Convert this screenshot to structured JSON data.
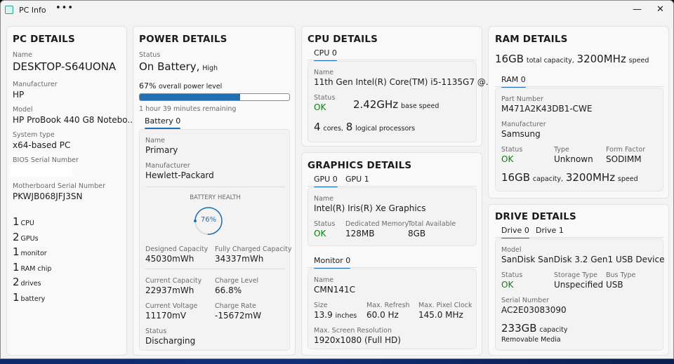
{
  "window": {
    "title": "PC Info",
    "more": "•••",
    "minimize": "—",
    "close": "✕"
  },
  "pc": {
    "heading": "PC DETAILS",
    "name_label": "Name",
    "name": "DESKTOP-S64UONA",
    "manufacturer_label": "Manufacturer",
    "manufacturer": "HP",
    "model_label": "Model",
    "model": "HP ProBook 440 G8 Notebo...",
    "system_type_label": "System type",
    "system_type": "x64-based PC",
    "bios_serial_label": "BIOS Serial Number",
    "mb_serial_label": "Motherboard Serial Number",
    "mb_serial": "PKWJB068JFJ3SN",
    "counts": [
      {
        "n": "1",
        "t": "CPU"
      },
      {
        "n": "2",
        "t": "GPUs"
      },
      {
        "n": "1",
        "t": "monitor"
      },
      {
        "n": "1",
        "t": "RAM chip"
      },
      {
        "n": "2",
        "t": "drives"
      },
      {
        "n": "1",
        "t": "battery"
      }
    ]
  },
  "power": {
    "heading": "POWER DETAILS",
    "status_label": "Status",
    "status": "On Battery,",
    "status_level": "High",
    "level_pct": "67%",
    "level_text": "overall power level",
    "level_value": 0.67,
    "remaining": "1 hour 39 minutes remaining",
    "tab": "Battery 0",
    "name_label": "Name",
    "name": "Primary",
    "manufacturer_label": "Manufacturer",
    "manufacturer": "Hewlett-Packard",
    "health_label": "BATTERY HEALTH",
    "health": "76%",
    "health_value": 0.76,
    "designed_label": "Designed Capacity",
    "designed": "45030mWh",
    "full_label": "Fully Charged Capacity",
    "full": "34337mWh",
    "current_cap_label": "Current Capacity",
    "current_cap": "22937mWh",
    "charge_level_label": "Charge Level",
    "charge_level": "66.8%",
    "voltage_label": "Current Voltage",
    "voltage": "11170mV",
    "rate_label": "Charge Rate",
    "rate": "-15672mW",
    "bstatus_label": "Status",
    "bstatus": "Discharging"
  },
  "cpu": {
    "heading": "CPU DETAILS",
    "tab": "CPU 0",
    "name_label": "Name",
    "name": "11th Gen Intel(R) Core(TM) i5-1135G7 @...",
    "status_label": "Status",
    "status": "OK",
    "speed": "2.42GHz",
    "speed_unit": "base speed",
    "cores": "4",
    "cores_unit": "cores,",
    "logical": "8",
    "logical_unit": "logical processors"
  },
  "gpu": {
    "heading": "GRAPHICS DETAILS",
    "tabs": [
      "GPU 0",
      "GPU 1"
    ],
    "name_label": "Name",
    "name": "Intel(R) Iris(R) Xe Graphics",
    "status_label": "Status",
    "status": "OK",
    "mem_label": "Dedicated Memory",
    "mem": "128MB",
    "total_label": "Total Available",
    "total": "8GB",
    "monitor_tab": "Monitor 0",
    "mon_name_label": "Name",
    "mon_name": "CMN141C",
    "size_label": "Size",
    "size": "13.9",
    "size_unit": "inches",
    "refresh_label": "Max. Refresh",
    "refresh": "60.0 Hz",
    "clock_label": "Max. Pixel Clock",
    "clock": "145.0 MHz",
    "res_label": "Max. Screen Resolution",
    "res": "1920x1080 (Full HD)"
  },
  "ram": {
    "heading": "RAM DETAILS",
    "total": "16GB",
    "total_unit": "total capacity,",
    "speed": "3200MHz",
    "speed_unit": "speed",
    "tab": "RAM 0",
    "part_label": "Part Number",
    "part": "M471A2K43DB1-CWE",
    "manufacturer_label": "Manufacturer",
    "manufacturer": "Samsung",
    "status_label": "Status",
    "status": "OK",
    "type_label": "Type",
    "type": "Unknown",
    "form_label": "Form Factor",
    "form": "SODIMM",
    "cap": "16GB",
    "cap_unit": "capacity,",
    "cap_speed": "3200MHz",
    "cap_speed_unit": "speed"
  },
  "drive": {
    "heading": "DRIVE DETAILS",
    "tabs": [
      "Drive 0",
      "Drive 1"
    ],
    "model_label": "Model",
    "model": "SanDisk SanDisk 3.2 Gen1 USB Device",
    "status_label": "Status",
    "status": "OK",
    "storage_label": "Storage Type",
    "storage": "Unspecified",
    "bus_label": "Bus Type",
    "bus": "USB",
    "serial_label": "Serial Number",
    "serial": "AC2E03083090",
    "capacity": "233GB",
    "capacity_unit": "capacity",
    "media": "Removable Media"
  },
  "colors": {
    "accent": "#1f6fb2",
    "ok": "#107c10"
  }
}
